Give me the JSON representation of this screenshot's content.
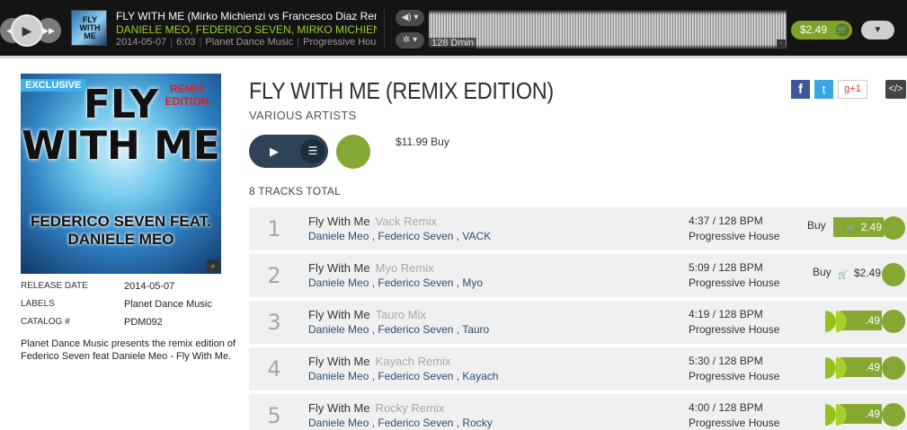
{
  "player": {
    "prev_icon": "rewind-icon",
    "play_icon": "play-icon",
    "next_icon": "fast-forward-icon",
    "now_playing": {
      "title": "FLY WITH ME (Mirko Michienzi vs Francesco Diaz Remix)",
      "artists": "DANIELE MEO, FEDERICO SEVEN, MIRKO MICHIENZI",
      "date": "2014-05-07",
      "duration": "6:03",
      "label": "Planet Dance Music",
      "genre": "Progressive House",
      "art_text": "FLY WITH ME"
    },
    "volume_icon": "volume-icon",
    "settings_icon": "gear-icon",
    "waveform_label": "128 Dmin",
    "waveform_marker": "-",
    "price": "$2.49",
    "cart_icon": "cart-icon",
    "menu_icon": "chevron-down-icon"
  },
  "release": {
    "title": "FLY WITH ME (REMIX EDITION)",
    "artist": "VARIOUS  ARTISTS",
    "buy_text": "$11.99 Buy",
    "tracks_total": "8  TRACKS TOTAL",
    "cover": {
      "badge": "EXCLUSIVE",
      "remix_text": "REMIX EDITION",
      "title_text": "FLY WITH ME",
      "feat_text": "FEDERICO SEVEN FEAT. DANIELE MEO",
      "zoom_icon": "zoom-icon"
    },
    "meta": [
      {
        "key": "RELEASE DATE",
        "value": "2014-05-07"
      },
      {
        "key": "LABELS",
        "value": "Planet Dance Music"
      },
      {
        "key": "CATALOG #",
        "value": "PDM092"
      }
    ],
    "description": "Planet Dance Music presents the remix edition of Federico Seven feat Daniele Meo - Fly With Me.",
    "share": {
      "facebook": "f",
      "twitter": "t",
      "gplus": "g+1",
      "embed": "</>"
    }
  },
  "tracks": [
    {
      "num": "1",
      "title": "Fly With Me",
      "mix": "Vack Remix",
      "artists": "Daniele Meo , Federico Seven , VACK",
      "bpm": "4:37 / 128 BPM",
      "genre": "Progressive House",
      "buy": "Buy",
      "price": "2.49"
    },
    {
      "num": "2",
      "title": "Fly With Me",
      "mix": "Myo Remix",
      "artists": "Daniele Meo , Federico Seven , Myo",
      "bpm": "5:09 / 128 BPM",
      "genre": "Progressive House",
      "buy": "Buy",
      "price": "$2.49"
    },
    {
      "num": "3",
      "title": "Fly With Me",
      "mix": "Tauro Mix",
      "artists": "Daniele Meo , Federico Seven , Tauro",
      "bpm": "4:19 / 128 BPM",
      "genre": "Progressive House",
      "price": ".49"
    },
    {
      "num": "4",
      "title": "Fly With Me",
      "mix": "Kayach Remix",
      "artists": "Daniele Meo , Federico Seven , Kayach",
      "bpm": "5:30 / 128 BPM",
      "genre": "Progressive House",
      "price": ".49"
    },
    {
      "num": "5",
      "title": "Fly With Me",
      "mix": "Rocky Remix",
      "artists": "Daniele Meo , Federico Seven , Rocky",
      "bpm": "4:00 / 128 BPM",
      "genre": "Progressive House",
      "price": ".49"
    }
  ]
}
